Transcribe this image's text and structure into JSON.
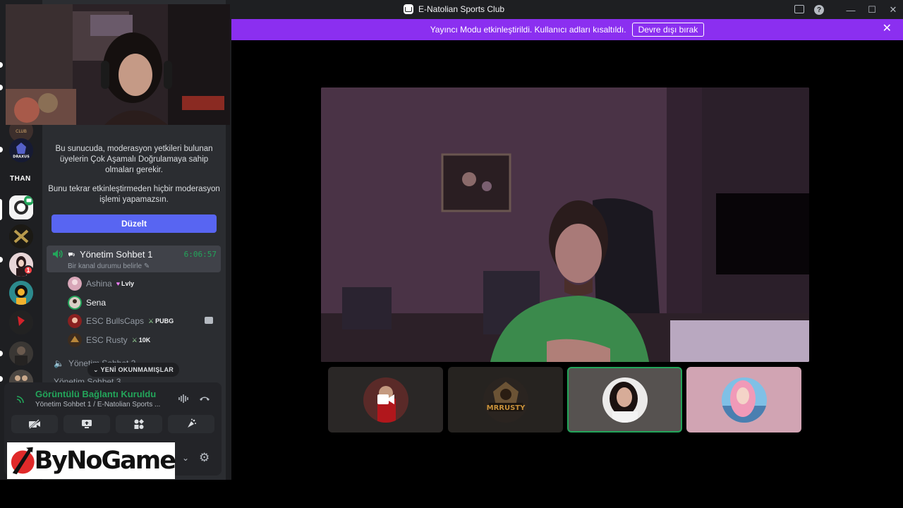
{
  "window": {
    "title": "E-Natolian Sports Club"
  },
  "banner": {
    "text": "Yayıncı Modu etkinleştirildi. Kullanıcı adları kısaltıldı.",
    "button": "Devre dışı bırak",
    "close_icon": "close-icon"
  },
  "rail": {
    "than_label": "THAN",
    "badge_count": "1"
  },
  "sidebar": {
    "mfa_notice": "Bu sunucuda, moderasyon yetkileri bulunan üyelerin Çok Aşamalı Doğrulamaya sahip olmaları gerekir.",
    "mfa_notice2": "Bunu tekrar etkinleştirmeden hiçbir moderasyon işlemi yapamazsın.",
    "fix_button": "Düzelt",
    "voice_channel": {
      "name": "Yönetim Sohbet 1",
      "timer": "6:06:57",
      "status": "Bir kanal durumu belirle"
    },
    "members": [
      {
        "name": "Ashina",
        "tag": "Lvly"
      },
      {
        "name": "Sena",
        "tag": ""
      },
      {
        "name": "ESC BullsCaps",
        "tag": "PUBG"
      },
      {
        "name": "ESC Rusty",
        "tag": "10K"
      }
    ],
    "channel2": "Yönetim Sohbet 2",
    "channel3": "Yönetim Sohbet 3",
    "unread_pill": "YENİ OKUNMAMIŞLAR"
  },
  "voice_panel": {
    "title": "Görüntülü Bağlantı Kuruldu",
    "subtitle": "Yönetim Sohbet 1 / E-Natolian Sports ..."
  },
  "overlay_logo": {
    "text": "ByNoGame"
  },
  "colors": {
    "banner": "#8b2ff0",
    "accent": "#5865f2",
    "connected": "#23a55a"
  }
}
